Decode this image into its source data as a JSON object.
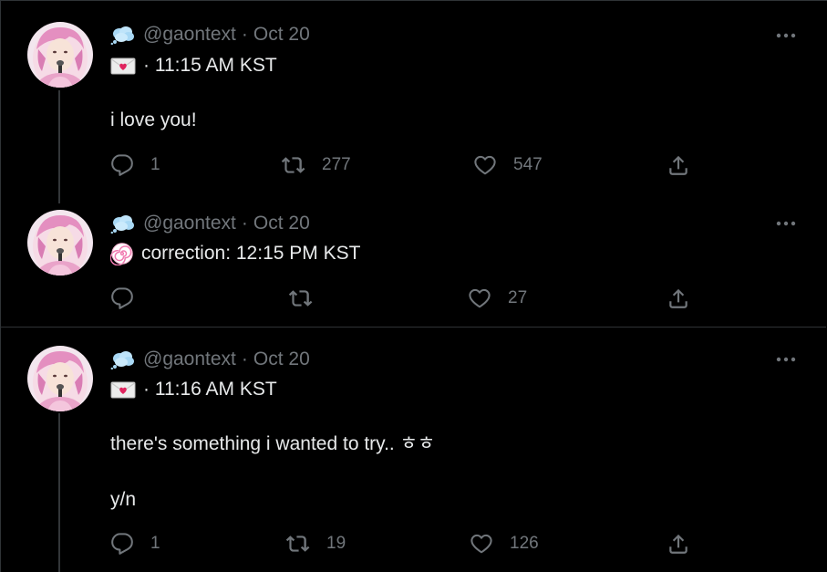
{
  "tweets": [
    {
      "handle": "@gaontext",
      "separator": "·",
      "date": "Oct 20",
      "subtitle_icon": "envelope-heart-icon",
      "subtitle": "· 11:15 AM KST",
      "text_lines": [
        "i love you!"
      ],
      "reply_count": "1",
      "retweet_count": "277",
      "like_count": "547"
    },
    {
      "handle": "@gaontext",
      "separator": "·",
      "date": "Oct 20",
      "subtitle_icon": "spiral-icon",
      "subtitle": "correction: 12:15 PM KST",
      "text_lines": [],
      "reply_count": "",
      "retweet_count": "",
      "like_count": "27"
    },
    {
      "handle": "@gaontext",
      "separator": "·",
      "date": "Oct 20",
      "subtitle_icon": "envelope-heart-icon",
      "subtitle": "· 11:16 AM KST",
      "text_lines": [
        "there's something i wanted to try.. ㅎㅎ",
        "y/n"
      ],
      "reply_count": "1",
      "retweet_count": "19",
      "like_count": "126"
    }
  ],
  "colors": {
    "background": "#000000",
    "text": "#e7e9ea",
    "muted": "#71767b",
    "divider": "#2f3336"
  }
}
